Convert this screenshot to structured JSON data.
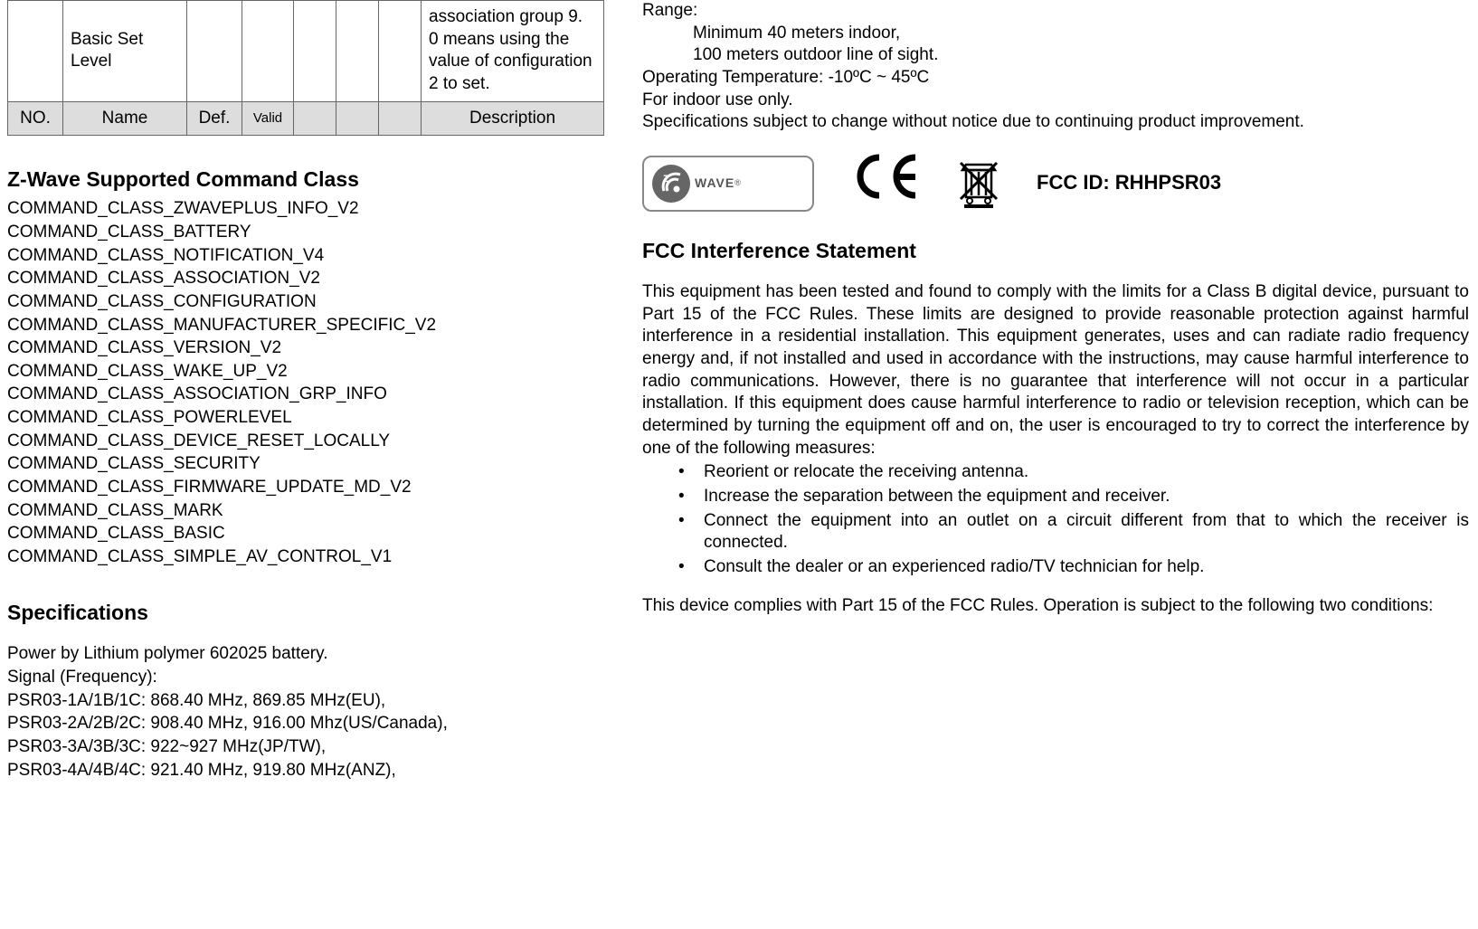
{
  "table": {
    "row1": {
      "name": "Basic Set Level",
      "desc": "association group 9.\n0 means using the value of configuration 2 to set."
    },
    "header": {
      "no": "NO.",
      "name": "Name",
      "def": "Def.",
      "valid": "Valid",
      "description": "Description"
    }
  },
  "left": {
    "h_zwave": "Z-Wave Supported Command Class",
    "cmds": [
      "COMMAND_CLASS_ZWAVEPLUS_INFO_V2",
      "COMMAND_CLASS_BATTERY",
      "COMMAND_CLASS_NOTIFICATION_V4",
      "COMMAND_CLASS_ASSOCIATION_V2",
      "COMMAND_CLASS_CONFIGURATION",
      "COMMAND_CLASS_MANUFACTURER_SPECIFIC_V2",
      "COMMAND_CLASS_VERSION_V2",
      "COMMAND_CLASS_WAKE_UP_V2",
      "COMMAND_CLASS_ASSOCIATION_GRP_INFO",
      "COMMAND_CLASS_POWERLEVEL",
      "COMMAND_CLASS_DEVICE_RESET_LOCALLY",
      "COMMAND_CLASS_SECURITY",
      "COMMAND_CLASS_FIRMWARE_UPDATE_MD_V2",
      "COMMAND_CLASS_MARK",
      "COMMAND_CLASS_BASIC",
      "COMMAND_CLASS_SIMPLE_AV_CONTROL_V1"
    ],
    "h_specs": "Specifications",
    "spec_power": "Power by Lithium polymer 602025 battery.",
    "spec_signal": "Signal (Frequency):",
    "spec_s1": "PSR03-1A/1B/1C: 868.40 MHz, 869.85 MHz(EU),",
    "spec_s2": "PSR03-2A/2B/2C: 908.40 MHz, 916.00 Mhz(US/Canada),",
    "spec_s3": "PSR03-3A/3B/3C: 922~927 MHz(JP/TW),",
    "spec_s4": "PSR03-4A/4B/4C: 921.40 MHz, 919.80 MHz(ANZ),"
  },
  "right": {
    "range": "Range:",
    "range_indoor": "Minimum 40 meters indoor,",
    "range_outdoor": "100 meters outdoor line of sight.",
    "optemp": "Operating Temperature: -10ºC ~ 45ºC",
    "indoor": "For indoor use only.",
    "changes": "Specifications subject to change without notice due to continuing product improvement.",
    "zwave_label": "WAVE",
    "fcc_id": "FCC ID: RHHPSR03",
    "h_fcc": "FCC Interference Statement",
    "fcc_p1": "This equipment has been tested and found to comply with the limits for a Class B digital device, pursuant to Part 15 of the FCC Rules. These limits are designed to provide reasonable protection against harmful interference in a residential installation. This equipment generates, uses and can radiate radio frequency energy and, if not installed and used in accordance with the instructions,  may cause harmful interference to radio communications.    However,   there is no guarantee that interference will not occur in a particular installation.  If this equipment does cause harmful interference to radio or television reception,  which can be determined by turning the equipment off and on,  the user is encouraged to try to correct the interference by one of the following measures:",
    "bullets": [
      "Reorient or relocate the receiving antenna.",
      "Increase the separation between the equipment and receiver.",
      "Connect the equipment into an outlet on a circuit different from that to which the receiver is connected.",
      "Consult the dealer or an experienced radio/TV technician for help."
    ],
    "fcc_p2": "This device complies with Part 15 of the FCC Rules. Operation is subject to the following two conditions:"
  }
}
